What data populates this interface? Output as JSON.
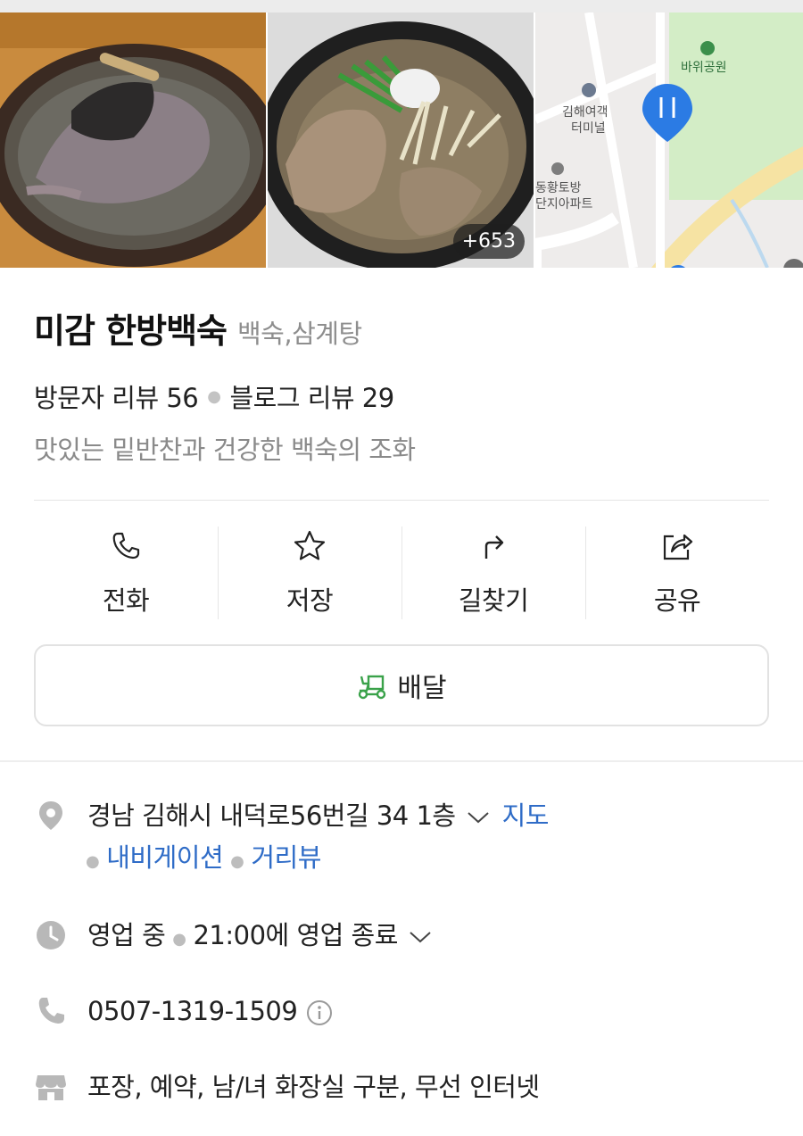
{
  "gallery": {
    "photos": [
      "photo-1",
      "photo-2",
      "map-preview"
    ],
    "more_count": "+653",
    "map_labels": {
      "park": "바위공원",
      "terminal_line1": "김해여객",
      "terminal_line2": "터미널",
      "apartment_line1": "동황토방",
      "apartment_line2": "단지아파트"
    }
  },
  "place": {
    "name": "미감 한방백숙",
    "category": "백숙,삼계탕",
    "visitor_reviews": "방문자 리뷰 56",
    "blog_reviews": "블로그 리뷰 29",
    "tagline": "맛있는 밑반찬과 건강한 백숙의 조화"
  },
  "actions": [
    {
      "label": "전화",
      "icon": "phone-icon"
    },
    {
      "label": "저장",
      "icon": "star-icon"
    },
    {
      "label": "길찾기",
      "icon": "directions-icon"
    },
    {
      "label": "공유",
      "icon": "share-icon"
    }
  ],
  "delivery": {
    "label": "배달",
    "icon": "delivery-icon",
    "color": "#3aa24a"
  },
  "info": {
    "address": "경남 김해시 내덕로56번길 34 1층",
    "map_link": "지도",
    "navigation_link": "내비게이션",
    "streetview_link": "거리뷰",
    "status": "영업 중",
    "hours": "21:00에 영업 종료",
    "phone": "0507-1319-1509",
    "amenities": "포장, 예약, 남/녀 화장실 구분, 무선 인터넷"
  },
  "colors": {
    "link": "#2f6cc7",
    "icon_grey": "#b8b8b8",
    "map_pin": "#2b7be4"
  }
}
